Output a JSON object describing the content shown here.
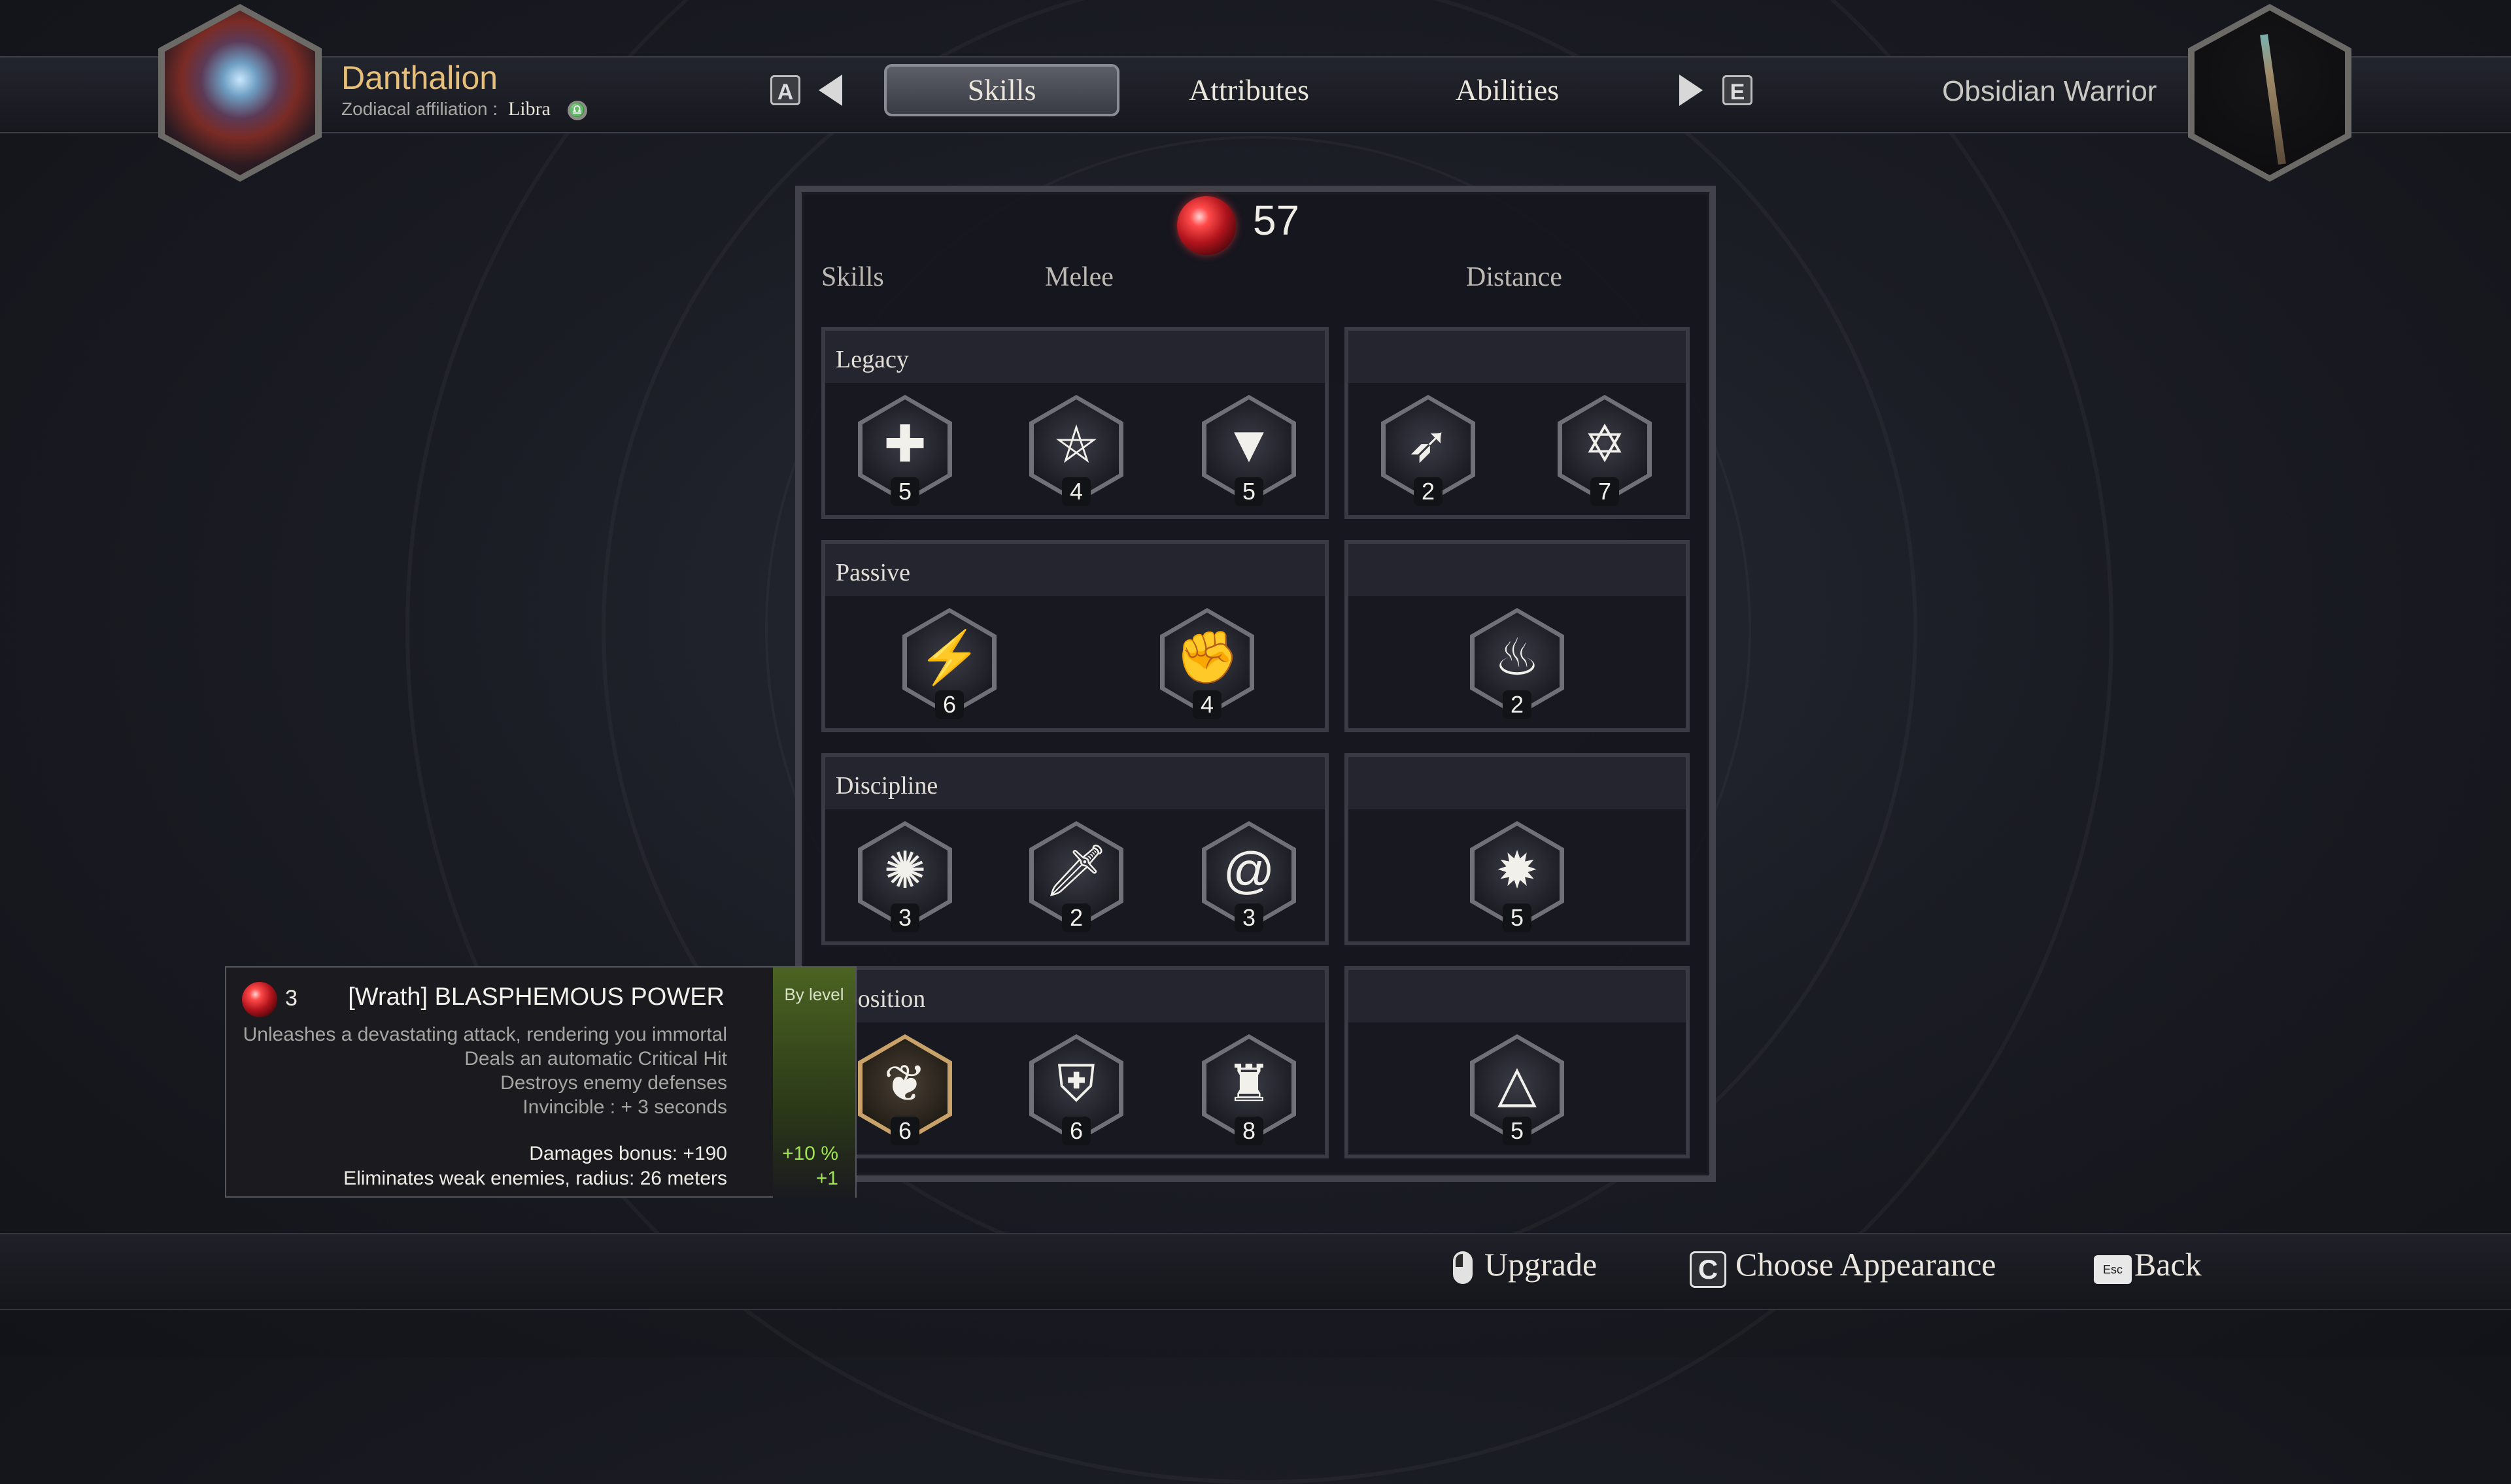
{
  "header": {
    "hero_name": "Danthalion",
    "zodiac_label": "Zodiacal affiliation :",
    "zodiac_value": "Libra",
    "prev_key": "A",
    "next_key": "E",
    "tabs": [
      {
        "label": "Skills",
        "active": true
      },
      {
        "label": "Attributes",
        "active": false
      },
      {
        "label": "Abilities",
        "active": false
      }
    ],
    "class_name": "Obsidian Warrior"
  },
  "panel": {
    "points": "57",
    "column_headers": [
      "Skills",
      "Melee",
      "Distance"
    ],
    "sections": [
      {
        "title": "Legacy",
        "melee": [
          {
            "icon": "medkit-icon",
            "level": "5"
          },
          {
            "icon": "pentagram-icon",
            "level": "4"
          },
          {
            "icon": "triangle-sigil-icon",
            "level": "5"
          }
        ],
        "distance": [
          {
            "icon": "arrow-ring-icon",
            "level": "2"
          },
          {
            "icon": "hexagram-icon",
            "level": "7"
          }
        ]
      },
      {
        "title": "Passive",
        "melee": [
          {
            "icon": "claw-strike-icon",
            "level": "6"
          },
          {
            "icon": "flaming-fist-icon",
            "level": "4"
          }
        ],
        "distance": [
          {
            "icon": "flaming-figure-icon",
            "level": "2"
          }
        ]
      },
      {
        "title": "Discipline",
        "melee": [
          {
            "icon": "shattered-eye-icon",
            "level": "3"
          },
          {
            "icon": "dagger-hand-icon",
            "level": "2"
          },
          {
            "icon": "spiral-head-icon",
            "level": "3"
          }
        ],
        "distance": [
          {
            "icon": "exploding-head-icon",
            "level": "5"
          }
        ]
      },
      {
        "title": "sposition",
        "melee": [
          {
            "icon": "tree-blast-icon",
            "level": "6",
            "selected": true
          },
          {
            "icon": "crest-shield-icon",
            "level": "6"
          },
          {
            "icon": "fortress-icon",
            "level": "8"
          }
        ],
        "distance": [
          {
            "icon": "barbed-triangle-icon",
            "level": "5"
          }
        ]
      }
    ]
  },
  "tooltip": {
    "cost": "3",
    "title": "[Wrath] BLASPHEMOUS POWER",
    "badge": "By level",
    "description": [
      "Unleashes a devastating attack, rendering you immortal",
      "Deals an automatic Critical Hit",
      "Destroys enemy defenses",
      "Invincible : + 3 seconds"
    ],
    "stats": [
      {
        "label": "Damages bonus: +190",
        "bonus": "+10 %"
      },
      {
        "label": "Eliminates weak enemies, radius: 26 meters",
        "bonus": "+1"
      }
    ]
  },
  "footer": {
    "upgrade_label": "Upgrade",
    "appearance_key": "C",
    "appearance_label": "Choose Appearance",
    "esc_key": "Esc",
    "back_label": "Back"
  },
  "colors": {
    "hero_name": "#e6c07a",
    "bonus_green": "#9ee64a",
    "selected_border": "#c9a26a"
  }
}
